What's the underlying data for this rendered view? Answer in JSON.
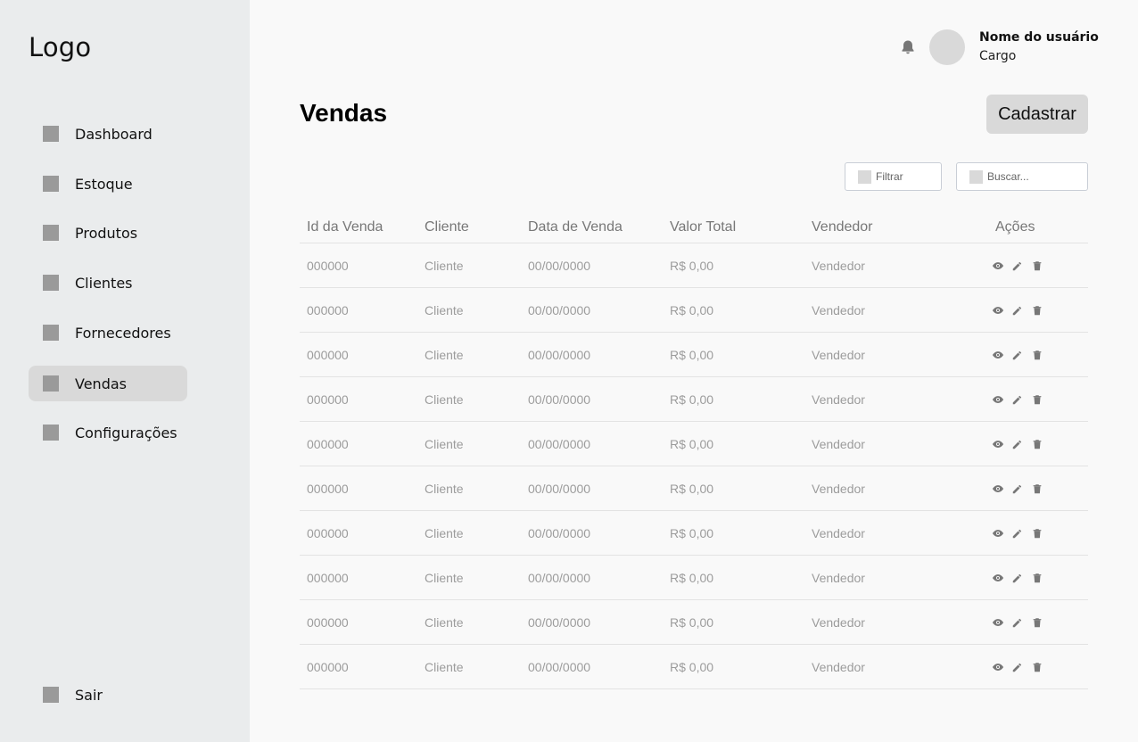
{
  "sidebar": {
    "logo": "Logo",
    "items": [
      {
        "label": "Dashboard",
        "icon": "dashboard-icon"
      },
      {
        "label": "Estoque",
        "icon": "estoque-icon"
      },
      {
        "label": "Produtos",
        "icon": "produtos-icon"
      },
      {
        "label": "Clientes",
        "icon": "clientes-icon"
      },
      {
        "label": "Fornecedores",
        "icon": "fornecedores-icon"
      },
      {
        "label": "Vendas",
        "icon": "vendas-icon",
        "active": true
      },
      {
        "label": "Configurações",
        "icon": "configuracoes-icon"
      }
    ],
    "logout": {
      "label": "Sair",
      "icon": "sair-icon"
    }
  },
  "header": {
    "bell_icon": "bell-icon",
    "user_name": "Nome do usuário",
    "user_role": "Cargo"
  },
  "main": {
    "title": "Vendas",
    "create_button": "Cadastrar",
    "filter_label": "Filtrar",
    "search_placeholder": "Buscar..."
  },
  "table": {
    "columns": [
      "Id da Venda",
      "Cliente",
      "Data de Venda",
      "Valor Total",
      "Vendedor",
      "Ações"
    ],
    "rows": [
      [
        "000000",
        "Cliente",
        "00/00/0000",
        "R$ 0,00",
        "Vendedor"
      ],
      [
        "000000",
        "Cliente",
        "00/00/0000",
        "R$ 0,00",
        "Vendedor"
      ],
      [
        "000000",
        "Cliente",
        "00/00/0000",
        "R$ 0,00",
        "Vendedor"
      ],
      [
        "000000",
        "Cliente",
        "00/00/0000",
        "R$ 0,00",
        "Vendedor"
      ],
      [
        "000000",
        "Cliente",
        "00/00/0000",
        "R$ 0,00",
        "Vendedor"
      ],
      [
        "000000",
        "Cliente",
        "00/00/0000",
        "R$ 0,00",
        "Vendedor"
      ],
      [
        "000000",
        "Cliente",
        "00/00/0000",
        "R$ 0,00",
        "Vendedor"
      ],
      [
        "000000",
        "Cliente",
        "00/00/0000",
        "R$ 0,00",
        "Vendedor"
      ],
      [
        "000000",
        "Cliente",
        "00/00/0000",
        "R$ 0,00",
        "Vendedor"
      ],
      [
        "000000",
        "Cliente",
        "00/00/0000",
        "R$ 0,00",
        "Vendedor"
      ]
    ],
    "row_actions": [
      "view-icon",
      "edit-icon",
      "delete-icon"
    ]
  },
  "colors": {
    "sidebar_bg": "#eaeced",
    "active_item_bg": "#d9d9d9",
    "page_bg": "#f9f9f9",
    "icon_gray": "#9a9a9a",
    "muted_text": "#9c9c9c"
  }
}
